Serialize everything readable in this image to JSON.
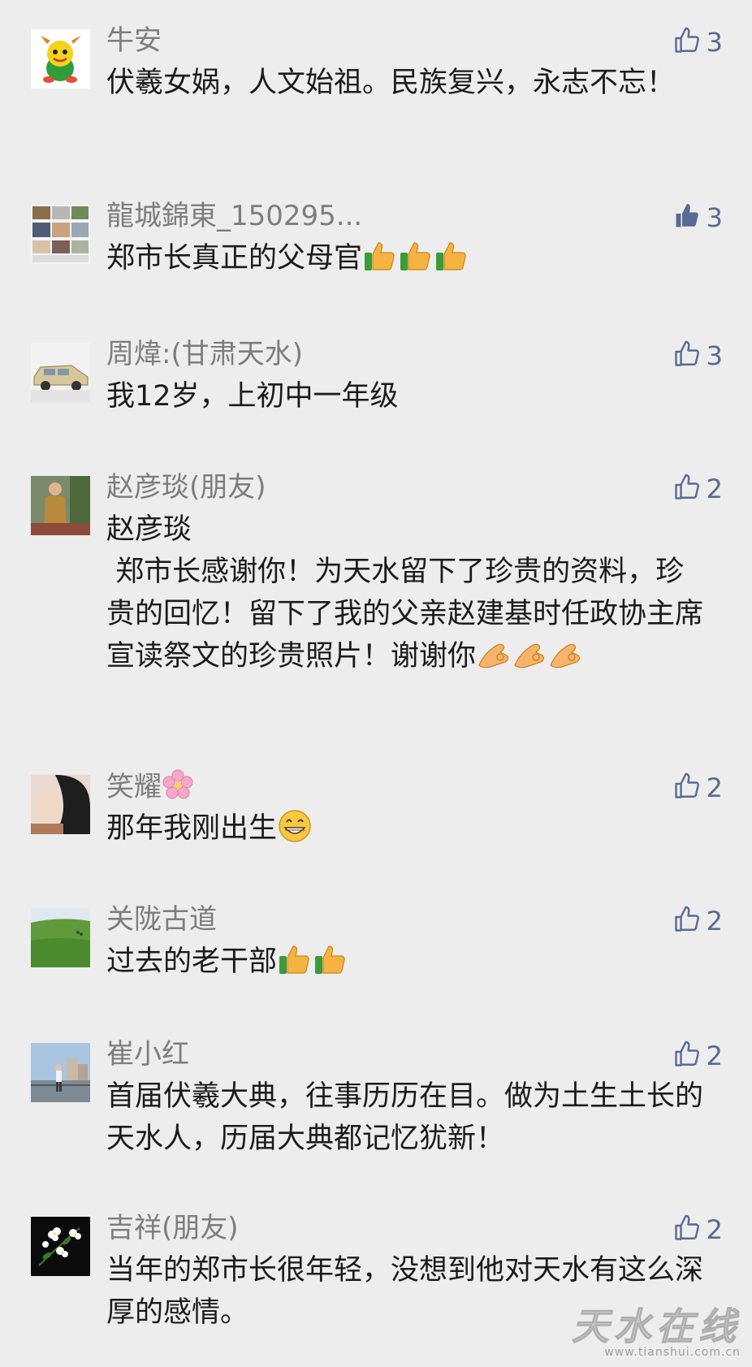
{
  "colors": {
    "background": "#ededed",
    "name": "#7d7d7d",
    "text": "#1b1b1b",
    "like_accent": "#576b95"
  },
  "comments": [
    {
      "name": "牛安",
      "text": "伏羲女娲，人文始祖。民族复兴，永志不忘！",
      "likes": "3",
      "liked": false
    },
    {
      "name": "龍城錦東_150295...",
      "text": "郑市长真正的父母官",
      "likes": "3",
      "liked": true
    },
    {
      "name": "周煒:(甘肃天水)",
      "text": "我12岁，上初中一年级",
      "likes": "3",
      "liked": false
    },
    {
      "name": "赵彦琰(朋友)",
      "text": "赵彦琰\n 郑市长感谢你！为天水留下了珍贵的资料，珍贵的回忆！留下了我的父亲赵建基时任政协主席宣读祭文的珍贵照片！谢谢你",
      "likes": "2",
      "liked": false
    },
    {
      "name": "笑耀",
      "text": "那年我刚出生",
      "likes": "2",
      "liked": false
    },
    {
      "name": "关陇古道",
      "text": "过去的老干部",
      "likes": "2",
      "liked": false
    },
    {
      "name": "崔小红",
      "text": "首届伏羲大典，往事历历在目。做为土生土长的天水人，历届大典都记忆犹新！",
      "likes": "2",
      "liked": false
    },
    {
      "name": "吉祥(朋友)",
      "text": "当年的郑市长很年轻，没想到他对天水有这么深厚的感情。",
      "likes": "2",
      "liked": false
    }
  ],
  "watermark": {
    "main": "天水在线",
    "url": "www.tianshui.com.cn"
  }
}
